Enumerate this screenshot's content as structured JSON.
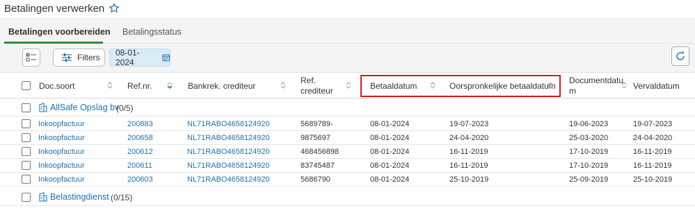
{
  "page": {
    "title": "Betalingen verwerken"
  },
  "tabs": [
    {
      "label": "Betalingen voorbereiden",
      "active": true
    },
    {
      "label": "Betalingsstatus",
      "active": false
    }
  ],
  "toolbar": {
    "filters_label": "Filters",
    "date_value": "08-01-2024"
  },
  "columns": {
    "doc_soort": "Doc.soort",
    "ref_nr": "Ref.nr.",
    "bankrek": "Bankrek. crediteur",
    "ref_crediteur_1": "Ref.",
    "ref_crediteur_2": "crediteur",
    "betaaldatum": "Betaaldatum",
    "oorspronkelijke": "Oorspronkelijke betaaldatum",
    "documentdatum_1": "Documentdatu",
    "documentdatum_2": "m",
    "vervaldatum": "Vervaldatum"
  },
  "groups": [
    {
      "name": "AllSafe Opslag bv",
      "count": "(0/5)"
    },
    {
      "name": "Belastingdienst",
      "count": "(0/15)"
    }
  ],
  "rows": [
    {
      "doc": "Inkoopfactuur",
      "ref": "200883",
      "bank": "NL71RABO4658124920",
      "refcred": "5689789-",
      "betaal": "08-01-2024",
      "oorspr": "19-07-2023",
      "docdatum": "19-06-2023",
      "verval": "19-07-2023"
    },
    {
      "doc": "Inkoopfactuur",
      "ref": "200658",
      "bank": "NL71RABO4658124920",
      "refcred": "9875697",
      "betaal": "08-01-2024",
      "oorspr": "24-04-2020",
      "docdatum": "25-03-2020",
      "verval": "24-04-2020"
    },
    {
      "doc": "Inkoopfactuur",
      "ref": "200612",
      "bank": "NL71RABO4658124920",
      "refcred": "468456898",
      "betaal": "08-01-2024",
      "oorspr": "16-11-2019",
      "docdatum": "17-10-2019",
      "verval": "16-11-2019"
    },
    {
      "doc": "Inkoopfactuur",
      "ref": "200611",
      "bank": "NL71RABO4658124920",
      "refcred": "83745487",
      "betaal": "08-01-2024",
      "oorspr": "16-11-2019",
      "docdatum": "17-10-2019",
      "verval": "16-11-2019"
    },
    {
      "doc": "Inkoopfactuur",
      "ref": "200603",
      "bank": "NL71RABO4658124920",
      "refcred": "5686790",
      "betaal": "08-01-2024",
      "oorspr": "25-10-2019",
      "docdatum": "25-09-2019",
      "verval": "25-10-2019"
    }
  ],
  "colors": {
    "accent": "#1f70b3",
    "tab_active": "#2e8b3a",
    "highlight": "#d11a1a"
  }
}
